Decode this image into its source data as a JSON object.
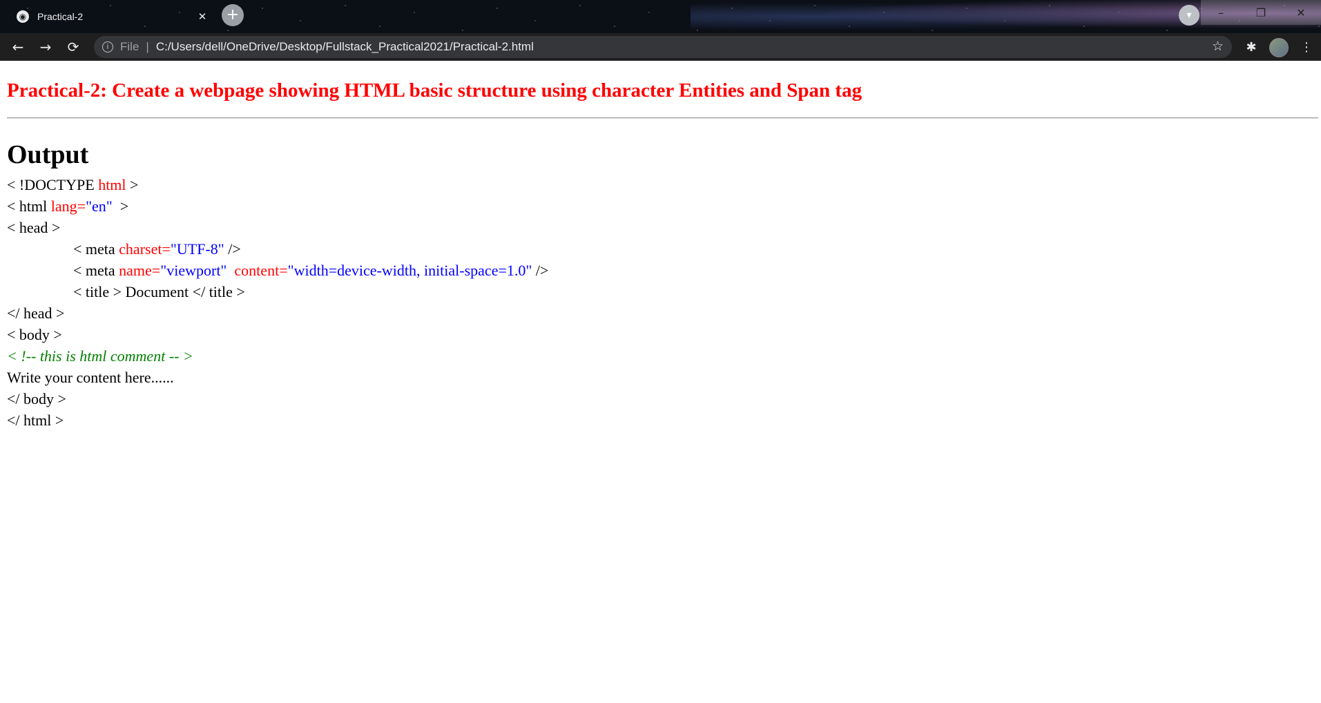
{
  "browser": {
    "tab": {
      "title": "Practical-2",
      "favicon": "globe-icon",
      "close": "✕"
    },
    "new_tab": "+",
    "address": {
      "file_label": "File",
      "separator": "|",
      "url": "C:/Users/dell/OneDrive/Desktop/Fullstack_Practical2021/Practical-2.html"
    },
    "icons": {
      "back": "←",
      "forward": "→",
      "reload": "⟳",
      "info": "i",
      "star": "☆",
      "extensions": "✱",
      "menu": "⋮",
      "profile": "▾",
      "minimize": "–",
      "restore": "❐",
      "close_window": "✕"
    }
  },
  "page": {
    "heading": "Practical-2: Create a webpage showing HTML basic structure using character Entities and Span tag",
    "output_title": "Output",
    "colors": {
      "heading": "#ff0000",
      "attribute": "#ff0000",
      "value": "#0000ff",
      "comment": "#008000"
    },
    "code": {
      "l1": {
        "a": "< !DOCTYPE ",
        "b": "html",
        "c": " >"
      },
      "l2": {
        "a": "< html ",
        "b": "lang",
        "c": "=",
        "d": "\"en\"",
        "e": "  >"
      },
      "l3": {
        "a": "< head >"
      },
      "l4": {
        "a": "< meta ",
        "b": "charset",
        "c": "=",
        "d": "\"UTF-8\"",
        "e": " />"
      },
      "l5": {
        "a": "< meta ",
        "b": "name",
        "c": "=",
        "d": "\"viewport\"",
        "e": "  ",
        "f": "content",
        "g": "=",
        "h": "\"width=device-width, initial-space=1.0\"",
        "i": " />"
      },
      "l6": {
        "a": "< title > Document </ title >"
      },
      "l7": {
        "a": "</ head >"
      },
      "l8": {
        "a": "< body >"
      },
      "l9": {
        "a": "< !-- this is html comment -- >"
      },
      "l10": {
        "a": "Write your content here......"
      },
      "l11": {
        "a": "</ body >"
      },
      "l12": {
        "a": "</ html >"
      }
    }
  }
}
